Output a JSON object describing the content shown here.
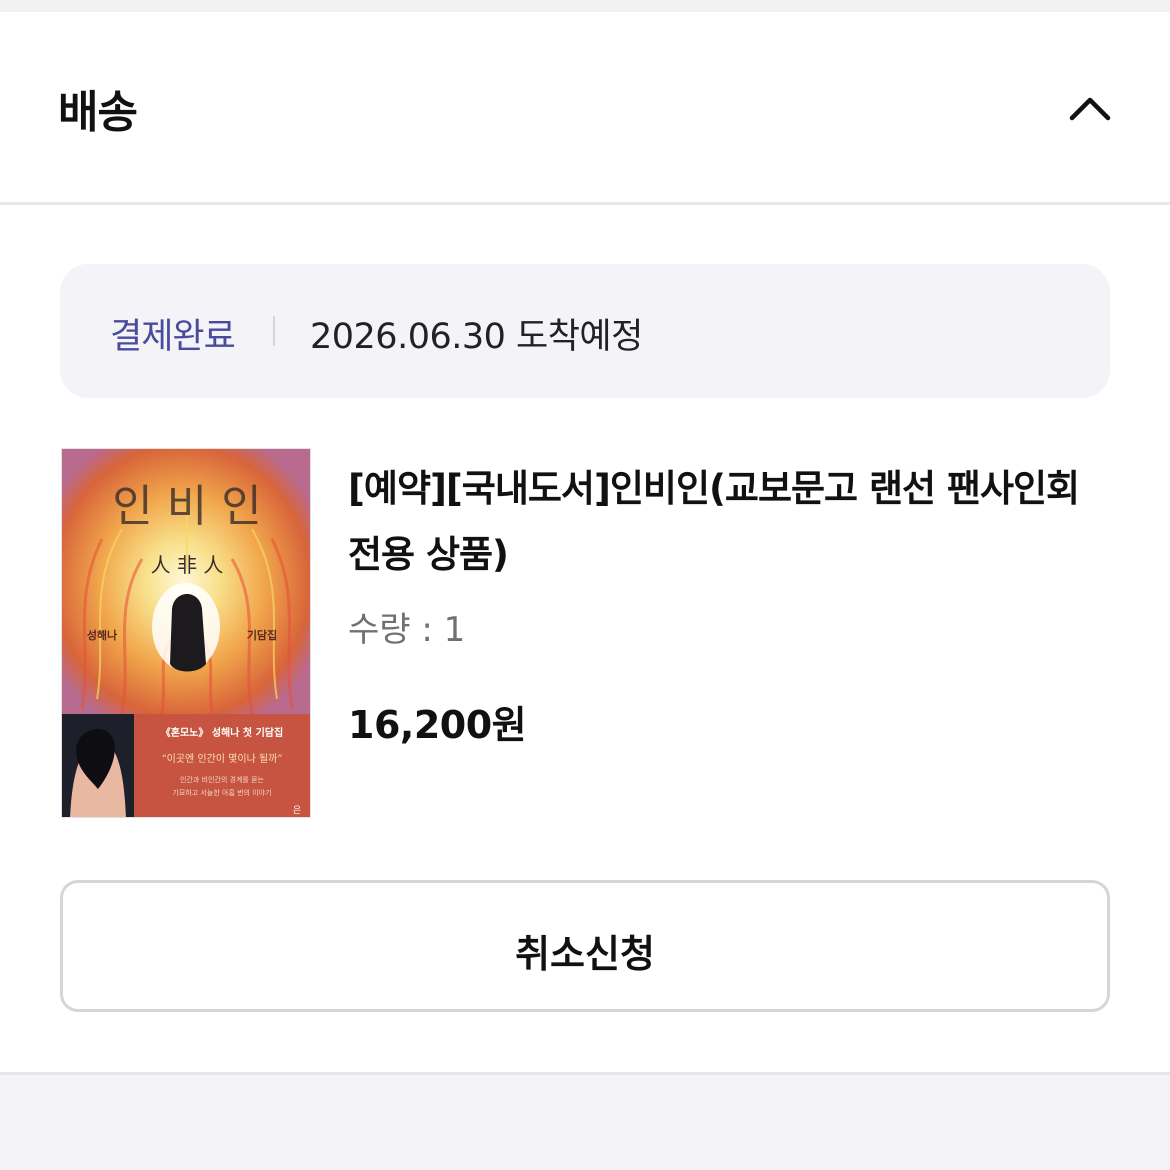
{
  "section": {
    "title": "배송",
    "collapse_icon": "chevron-up-icon"
  },
  "status": {
    "label": "결제완료",
    "delivery": "2026.06.30 도착예정"
  },
  "product": {
    "title": "[예약][국내도서]인비인(교보문고 랜선 팬사인회 전용 상품)",
    "quantity": "수량 : 1",
    "price": "16,200원",
    "cover": {
      "title": "인 비 인",
      "hanja": "人 非 人",
      "author": "성해나",
      "genre": "기담집",
      "band_title": "《혼모노》 성해나 첫 기담집",
      "quote": "“이곳엔 인간이 몇이나 될까”",
      "blurb_1": "인간과 비인간의 경계를 묻는",
      "blurb_2": "기묘하고 서늘한 아홉 번의 이야기",
      "publisher_mark": "은"
    }
  },
  "actions": {
    "cancel_label": "취소신청"
  },
  "colors": {
    "status_accent": "#4a4b9a",
    "status_bg": "#f3f3f8",
    "button_border": "#d6d6d6",
    "cover_band": "#c65440"
  }
}
